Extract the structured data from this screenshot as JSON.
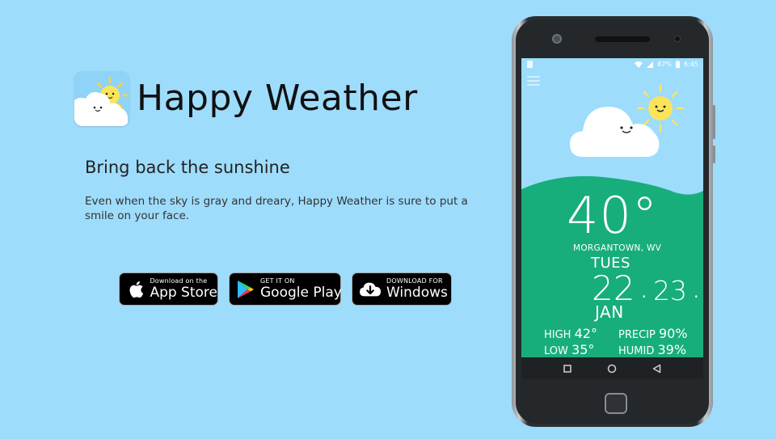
{
  "app": {
    "title": "Happy Weather",
    "tagline": "Bring back the sunshine",
    "description": "Even when the sky is gray and dreary, Happy Weather is sure to put a smile on your face."
  },
  "store_buttons": {
    "appstore": {
      "small": "Download on the",
      "big": "App Store",
      "icon": "apple-icon"
    },
    "gplay": {
      "small": "GET IT ON",
      "big": "Google Play",
      "icon": "google-play-icon"
    },
    "windows": {
      "small": "DOWNLOAD FOR",
      "big": "Windows",
      "icon": "cloud-download-icon"
    }
  },
  "phone": {
    "status": {
      "battery": "87%",
      "time": "6:45"
    },
    "weather": {
      "temperature": "40°",
      "location": "MORGANTOWN, WV",
      "day": "TUES",
      "date_day": "22",
      "date_minute": "23",
      "month": "JAN",
      "high_label": "HIGH",
      "high_value": "42°",
      "low_label": "LOW",
      "low_value": "35°",
      "precip_label": "PRECIP",
      "precip_value": "90%",
      "humid_label": "HUMID",
      "humid_value": "39%"
    }
  },
  "colors": {
    "background": "#9edcfc",
    "green": "#17ae7c",
    "sun": "#fbe45a",
    "cloud": "#ffffff"
  }
}
